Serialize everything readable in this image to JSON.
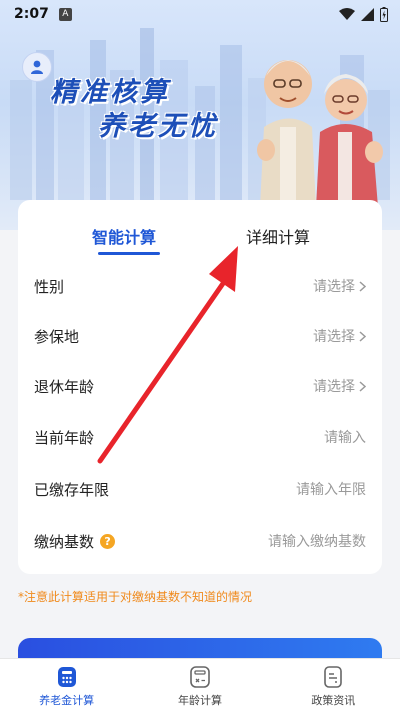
{
  "status_bar": {
    "time": "2:07",
    "notif_letter": "A"
  },
  "banner": {
    "title_line1": "精准核算",
    "title_line2": "养老无忧"
  },
  "tabs": {
    "smart": "智能计算",
    "detail": "详细计算"
  },
  "form": {
    "rows": [
      {
        "label": "性别",
        "value": "请选择"
      },
      {
        "label": "参保地",
        "value": "请选择"
      },
      {
        "label": "退休年龄",
        "value": "请选择"
      },
      {
        "label": "当前年龄",
        "value": "请输入"
      },
      {
        "label": "已缴存年限",
        "value": "请输入年限"
      },
      {
        "label": "缴纳基数",
        "value": "请输入缴纳基数"
      }
    ],
    "help_glyph": "?"
  },
  "note": "*注意此计算适用于对缴纳基数不知道的情况",
  "bottom_nav": {
    "items": [
      {
        "label": "养老金计算",
        "active": true
      },
      {
        "label": "年龄计算",
        "active": false
      },
      {
        "label": "政策资讯",
        "active": false
      }
    ]
  },
  "colors": {
    "accent": "#1f57d6",
    "annotation_arrow": "#e8242b",
    "note": "#f08a1c"
  }
}
